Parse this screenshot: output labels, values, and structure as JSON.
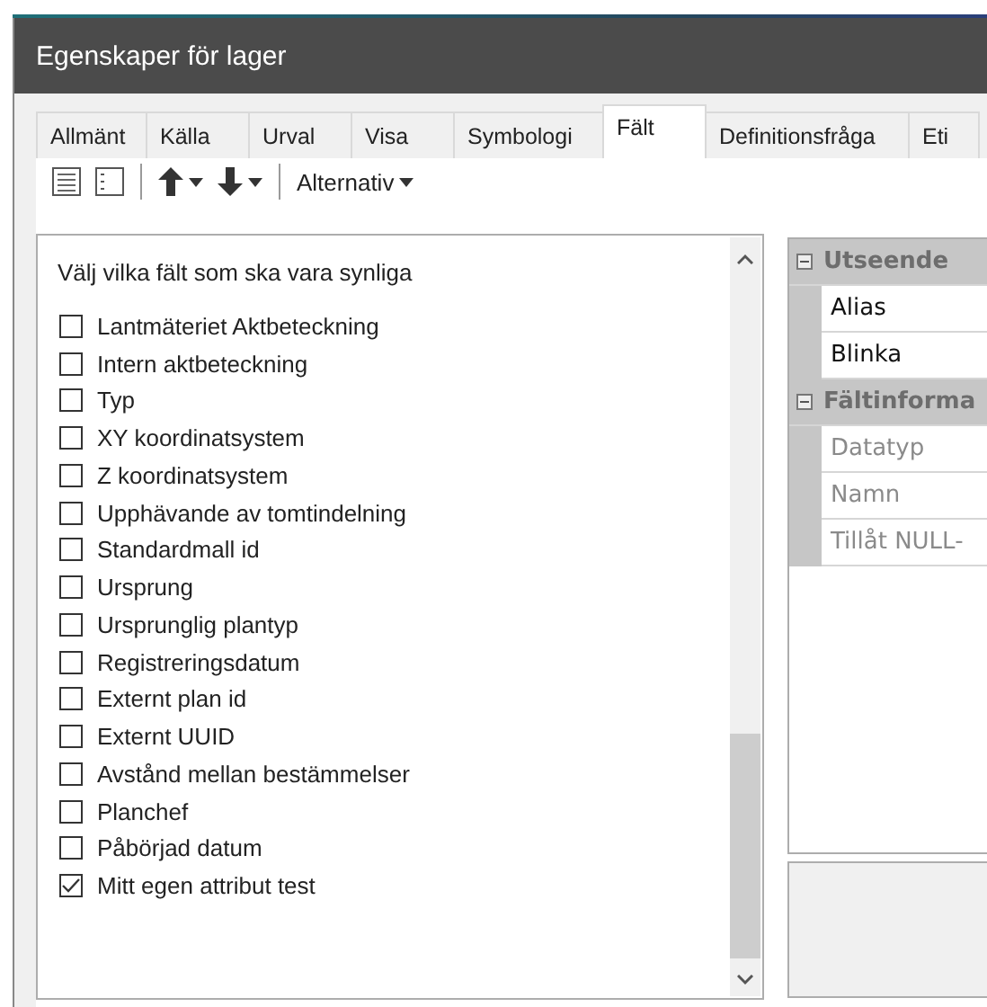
{
  "window": {
    "title": "Egenskaper för lager"
  },
  "tabs": [
    {
      "label": "Allmänt",
      "selected": false
    },
    {
      "label": "Källa",
      "selected": false
    },
    {
      "label": "Urval",
      "selected": false
    },
    {
      "label": "Visa",
      "selected": false
    },
    {
      "label": "Symbologi",
      "selected": false
    },
    {
      "label": "Fält",
      "selected": true
    },
    {
      "label": "Definitionsfråga",
      "selected": false
    },
    {
      "label": "Eti",
      "selected": false
    }
  ],
  "toolbar": {
    "options_button": "Alternativ"
  },
  "field_list": {
    "heading": "Välj vilka fält som ska vara synliga",
    "fields": [
      {
        "label": "Lantmäteriet Aktbeteckning",
        "checked": false
      },
      {
        "label": "Intern aktbeteckning",
        "checked": false
      },
      {
        "label": "Typ",
        "checked": false
      },
      {
        "label": "XY koordinatsystem",
        "checked": false
      },
      {
        "label": "Z koordinatsystem",
        "checked": false
      },
      {
        "label": "Upphävande av tomtindelning",
        "checked": false
      },
      {
        "label": "Standardmall id",
        "checked": false
      },
      {
        "label": "Ursprung",
        "checked": false
      },
      {
        "label": "Ursprunglig plantyp",
        "checked": false
      },
      {
        "label": "Registreringsdatum",
        "checked": false
      },
      {
        "label": "Externt plan id",
        "checked": false
      },
      {
        "label": "Externt UUID",
        "checked": false
      },
      {
        "label": "Avstånd mellan bestämmelser",
        "checked": false
      },
      {
        "label": "Planchef",
        "checked": false
      },
      {
        "label": "Påbörjad datum",
        "checked": false
      },
      {
        "label": "Mitt egen attribut test",
        "checked": true
      }
    ]
  },
  "property_grid": {
    "sections": [
      {
        "title": "Utseende",
        "expanded": true,
        "rows": [
          {
            "label": "Alias",
            "disabled": false
          },
          {
            "label": "Blinka",
            "disabled": false
          }
        ]
      },
      {
        "title": "Fältinforma",
        "expanded": true,
        "rows": [
          {
            "label": "Datatyp",
            "disabled": true
          },
          {
            "label": "Namn",
            "disabled": true
          },
          {
            "label": "Tillåt NULL-",
            "disabled": true
          }
        ]
      }
    ]
  }
}
